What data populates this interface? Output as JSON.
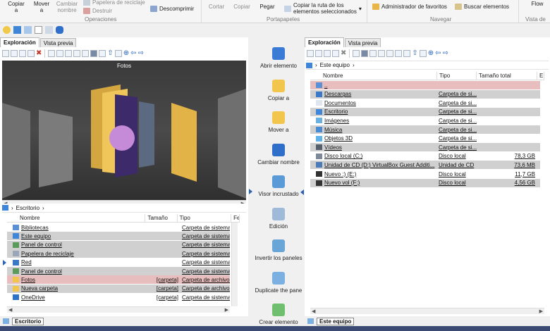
{
  "ribbon": {
    "copy": "Copiar\na",
    "move": "Mover\na",
    "rename": "Cambiar\nnombre",
    "recycle": "Papelera de reciclaje",
    "destroy": "Destruir",
    "decompress": "Descomprimir",
    "group_operations": "Operaciones",
    "cut": "Cortar",
    "copy2": "Copiar",
    "paste": "Pegar",
    "copy_path": "Copiar la ruta de los\nelementos seleccionados",
    "group_clipboard": "Portapapeles",
    "favorites_admin": "Administrador de favoritos",
    "search_items": "Buscar elementos",
    "group_navigate": "Navegar",
    "flow": "Flow",
    "group_view": "Vista de"
  },
  "left": {
    "tabs": [
      "Exploración",
      "Vista previa"
    ],
    "preview_title": "Fotos",
    "address": "Escritorio",
    "columns": [
      "Nombre",
      "Tamaño",
      "Tipo",
      "Fe"
    ],
    "rows": [
      {
        "name": "Bibliotecas",
        "size": "",
        "type": "Carpeta de sistema",
        "color": "#5b8fd6"
      },
      {
        "name": "Este equipo",
        "size": "",
        "type": "Carpeta de sistema",
        "color": "#3f86d9"
      },
      {
        "name": "Panel de control",
        "size": "",
        "type": "Carpeta de sistema",
        "color": "#5a9a5a"
      },
      {
        "name": "Papelera de reciclaje",
        "size": "",
        "type": "Carpeta de sistema",
        "color": "#9aa7b8"
      },
      {
        "name": "Red",
        "size": "",
        "type": "Carpeta de sistema",
        "color": "#3a78c8"
      },
      {
        "name": "Panel de control",
        "size": "",
        "type": "Carpeta de sistema",
        "color": "#5a9a5a"
      },
      {
        "name": "Fotos",
        "size": "[carpeta]",
        "type": "Carpeta de archivos",
        "color": "#f2c64c"
      },
      {
        "name": "Nueva carpeta",
        "size": "[carpeta]",
        "type": "Carpeta de archivos",
        "color": "#f2c64c"
      },
      {
        "name": "OneDrive",
        "size": "[carpeta]",
        "type": "Carpeta de sistema",
        "color": "#2d73c8"
      }
    ],
    "status": "Escritorio"
  },
  "middle": [
    {
      "label": "Abrir elemento"
    },
    {
      "label": "Copiar a"
    },
    {
      "label": "Mover a"
    },
    {
      "label": "Cambiar nombre"
    },
    {
      "label": "Visor incrustado"
    },
    {
      "label": "Edición"
    },
    {
      "label": "Invertir los paneles"
    },
    {
      "label": "Duplicate the pane"
    },
    {
      "label": "Crear elemento"
    }
  ],
  "right": {
    "tabs": [
      "Exploración",
      "Vista previa"
    ],
    "address": "Este equipo",
    "columns": [
      "Nombre",
      "Tipo",
      "Tamaño total",
      "E"
    ],
    "rows": [
      {
        "name": "..",
        "type": "",
        "size": "",
        "color": "#5b8fd6"
      },
      {
        "name": "Descargas",
        "type": "Carpeta de si...",
        "size": "",
        "color": "#3a78c8"
      },
      {
        "name": "Documentos",
        "type": "Carpeta de si...",
        "size": "",
        "color": "#dfe6ef"
      },
      {
        "name": "Escritorio",
        "type": "Carpeta de si...",
        "size": "",
        "color": "#3f86d9"
      },
      {
        "name": "Imágenes",
        "type": "Carpeta de si...",
        "size": "",
        "color": "#6ab0e0"
      },
      {
        "name": "Música",
        "type": "Carpeta de si...",
        "size": "",
        "color": "#4a8bd6"
      },
      {
        "name": "Objetos 3D",
        "type": "Carpeta de si...",
        "size": "",
        "color": "#5fb3e8"
      },
      {
        "name": "Vídeos",
        "type": "Carpeta de si...",
        "size": "",
        "color": "#555e6b"
      },
      {
        "name": "Disco local (C:)",
        "type": "Disco local",
        "size": "78,3 GB",
        "color": "#7e8a99"
      },
      {
        "name": "Unidad de CD (D:) VirtualBox Guest Additi...",
        "type": "Unidad de CD",
        "size": "73,6 MB",
        "color": "#4a7bb8"
      },
      {
        "name": "Nuevo :) (E:)",
        "type": "Disco local",
        "size": "11,7 GB",
        "color": "#333"
      },
      {
        "name": "Nuevo vol (F:)",
        "type": "Disco local",
        "size": "4,56 GB",
        "color": "#333"
      }
    ],
    "status": "Este equipo"
  },
  "colors": {
    "accent": "#2a63b8",
    "highlight_gray": "#d0d0d0",
    "highlight_pink": "#e8bdbd",
    "bottom_strip": "#3b4a73"
  }
}
